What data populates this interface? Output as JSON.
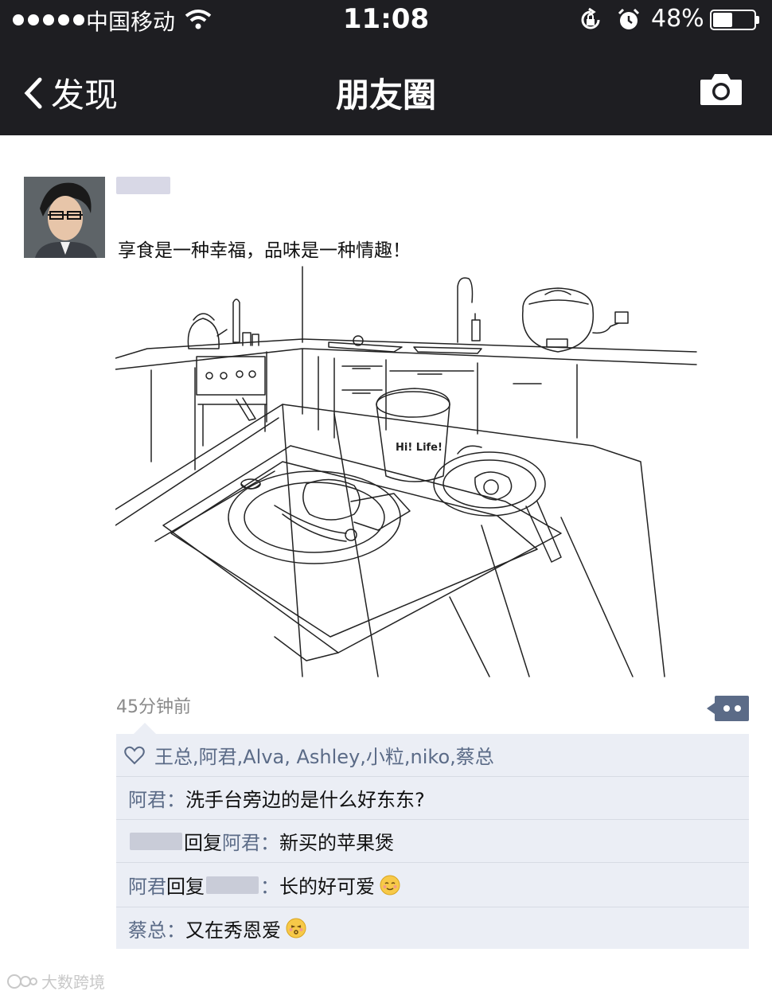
{
  "status_bar": {
    "carrier": "中国移动",
    "time": "11:08",
    "battery_percent": "48%",
    "battery_level": 0.48
  },
  "nav": {
    "back_label": "发现",
    "title": "朋友圈"
  },
  "post": {
    "text": "享食是一种幸福，品味是一种情趣！",
    "image_text": "Hi! Life!",
    "time_ago": "45分钟前",
    "likes": "王总,阿君,Alva, Ashley,小粒,niko,蔡总",
    "comments": [
      {
        "name": "阿君",
        "sep": "：",
        "text": "洗手台旁边的是什么好东东?"
      },
      {
        "reply_label": "回复",
        "to": "阿君",
        "sep": "：",
        "text": "新买的苹果煲"
      },
      {
        "name": "阿君",
        "reply_label": "回复",
        "sep": "：",
        "text": "长的好可爱"
      },
      {
        "name": "蔡总",
        "sep": "：",
        "text": "又在秀恩爱"
      }
    ]
  },
  "watermark": "大数跨境",
  "colors": {
    "bar": "#1e1e22",
    "link": "#5b6b87",
    "panel": "#ebeef5"
  }
}
